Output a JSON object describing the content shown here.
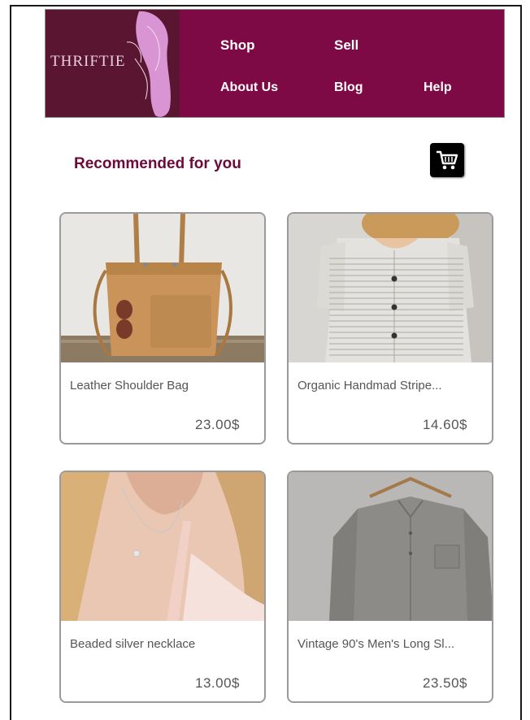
{
  "brand": {
    "logo_text": "THRIFTIE",
    "colors": {
      "logo_bg": "#5a1530",
      "nav_bg": "#7d0a44",
      "accent": "#6d0a3a"
    }
  },
  "nav": {
    "shop": "Shop",
    "sell": "Sell",
    "about": "About Us",
    "blog": "Blog",
    "help": "Help"
  },
  "section": {
    "title": "Recommended for you",
    "cart_icon": "shopping-cart-icon"
  },
  "products": [
    {
      "name": "Leather Shoulder Bag",
      "price": "23.00$",
      "image": "leather-bag-photo"
    },
    {
      "name": "Organic Handmad Stripe...",
      "price": "14.60$",
      "image": "striped-dress-photo"
    },
    {
      "name": "Beaded silver necklace",
      "price": "13.00$",
      "image": "necklace-photo"
    },
    {
      "name": "Vintage 90's Men's Long Sl...",
      "price": "23.50$",
      "image": "mens-shirt-photo"
    }
  ]
}
